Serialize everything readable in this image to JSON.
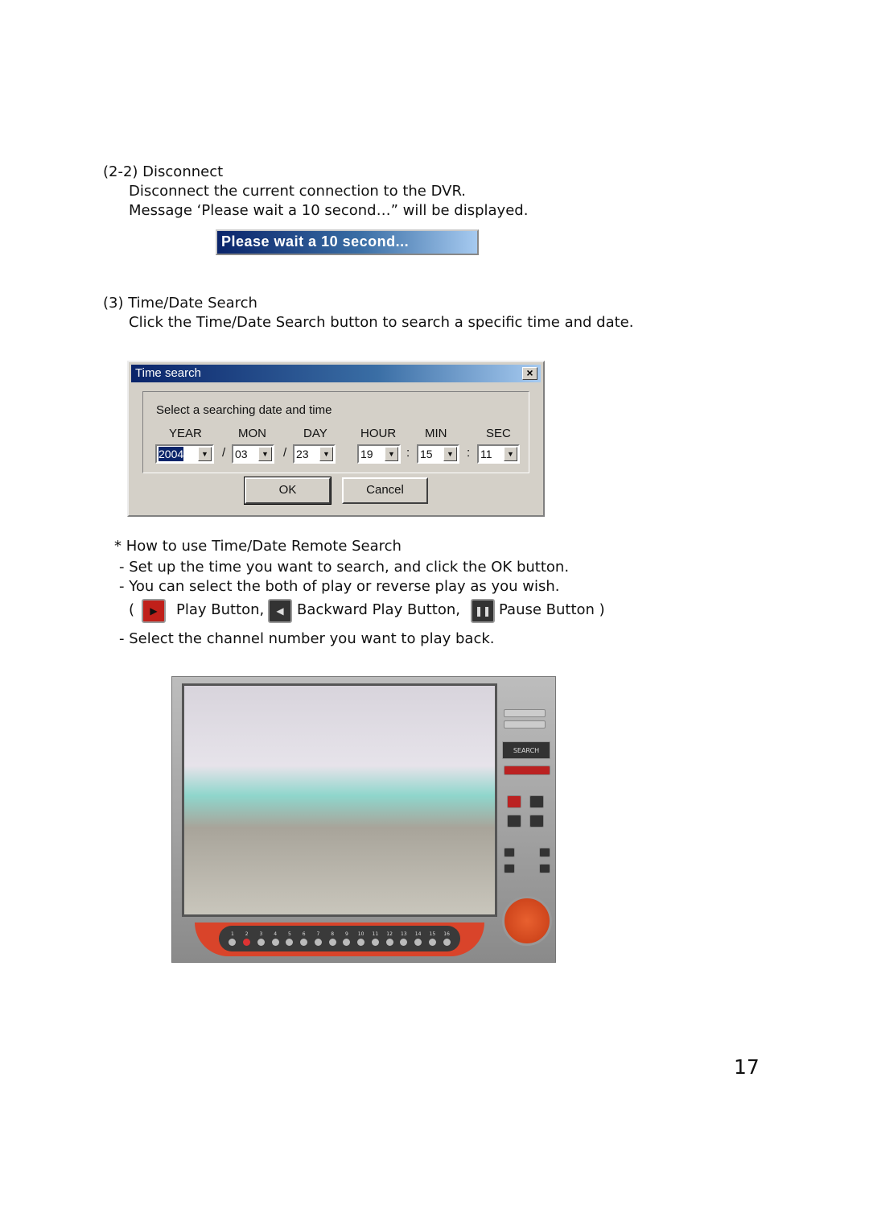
{
  "section_2_2": {
    "heading": "(2-2) Disconnect",
    "line1": "Disconnect the current connection to the DVR.",
    "line2": "Message ‘Please wait a 10 second…” will be displayed.",
    "message_box": "Please wait a 10 second..."
  },
  "section_3": {
    "heading": "(3) Time/Date Search",
    "line1": "Click the Time/Date Search button to search a specific time and date."
  },
  "dialog": {
    "title": "Time search",
    "close": "×",
    "group_label": "Select a searching date and time",
    "fields": [
      {
        "label": "YEAR",
        "value": "2004"
      },
      {
        "label": "MON",
        "value": "03"
      },
      {
        "label": "DAY",
        "value": "23"
      },
      {
        "label": "HOUR",
        "value": "19"
      },
      {
        "label": "MIN",
        "value": "15"
      },
      {
        "label": "SEC",
        "value": "11"
      }
    ],
    "separators": [
      "/",
      "/",
      ":",
      ":"
    ],
    "ok": "OK",
    "cancel": "Cancel"
  },
  "howto": {
    "heading": "* How to use Time/Date Remote Search",
    "step1": "- Set up the time you want to search, and click the OK button.",
    "step2": "- You can select the both of play or reverse play as you wish.",
    "paren_open": "(",
    "play": "Play Button,",
    "backward": "Backward Play Button,",
    "pause": "Pause Button )",
    "step3": "- Select the channel number you want to play back."
  },
  "dvr": {
    "search_label": "SEARCH",
    "channels": [
      "1",
      "2",
      "3",
      "4",
      "5",
      "6",
      "7",
      "8",
      "9",
      "10",
      "11",
      "12",
      "13",
      "14",
      "15",
      "16"
    ],
    "active_channel": "2"
  },
  "page_number": "17",
  "colors": {
    "titlebar": "#0a246a",
    "dialog_bg": "#d4d0c8",
    "play_icon": "#c0201a",
    "dvr_accent": "#d9442a"
  }
}
